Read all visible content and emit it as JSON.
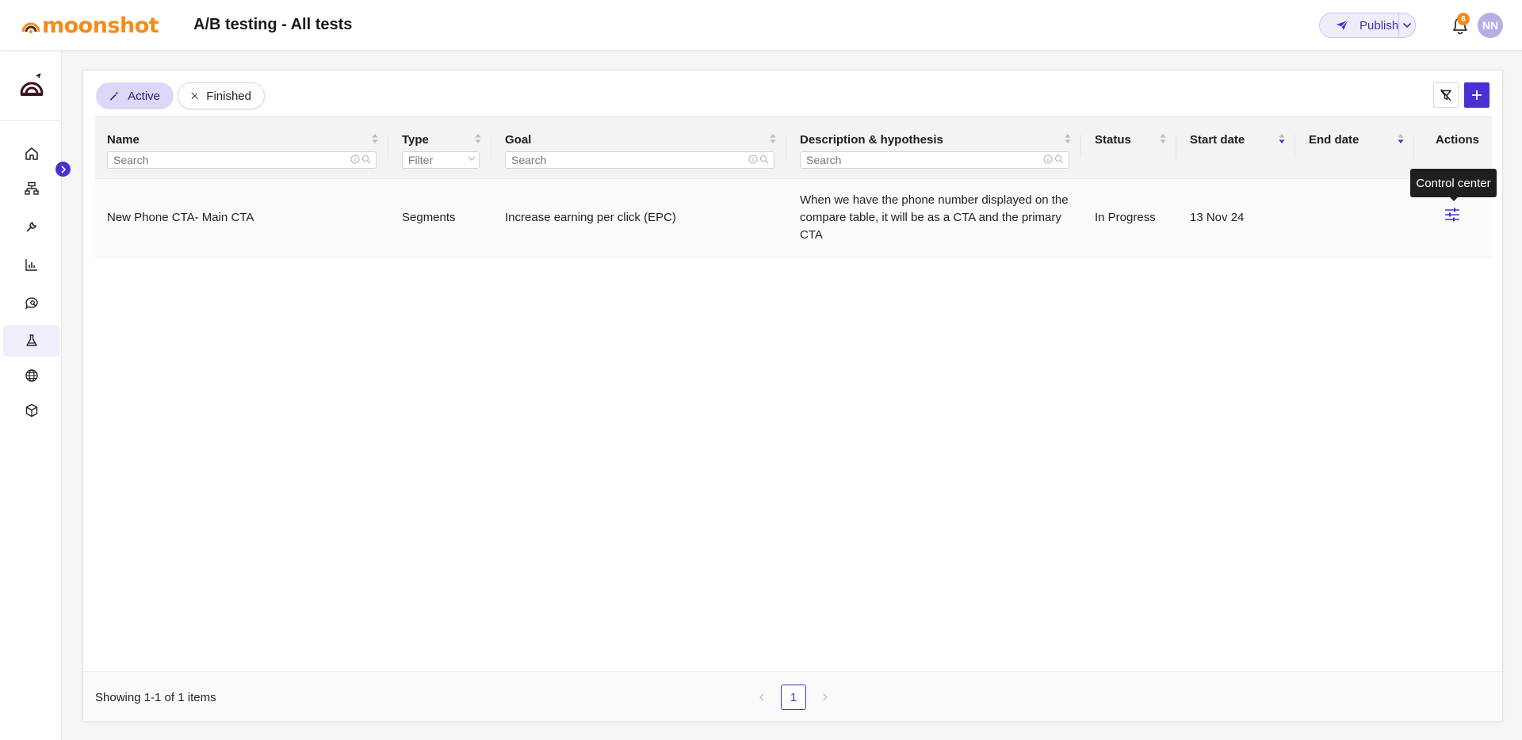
{
  "header": {
    "logo_text": "moonshot",
    "title": "A/B testing - All tests",
    "publish_label": "Publish",
    "notification_count": "6",
    "avatar_initials": "NN"
  },
  "sidebar": {
    "items": [
      {
        "name": "home",
        "icon": "home-icon"
      },
      {
        "name": "sitemap",
        "icon": "sitemap-icon"
      },
      {
        "name": "tools",
        "icon": "wrench-icon"
      },
      {
        "name": "analytics",
        "icon": "bar-chart-icon"
      },
      {
        "name": "search-messages",
        "icon": "chat-search-icon"
      },
      {
        "name": "ab-testing",
        "icon": "flask-icon",
        "active": true
      },
      {
        "name": "websites",
        "icon": "globe-icon"
      },
      {
        "name": "products",
        "icon": "cube-icon"
      }
    ]
  },
  "filters": {
    "active_label": "Active",
    "finished_label": "Finished"
  },
  "table": {
    "columns": {
      "name": "Name",
      "type": "Type",
      "goal": "Goal",
      "description": "Description & hypothesis",
      "status": "Status",
      "start_date": "Start date",
      "end_date": "End date",
      "actions": "Actions"
    },
    "placeholders": {
      "name": "Search",
      "type": "Filter",
      "goal": "Search",
      "description": "Search"
    },
    "rows": [
      {
        "name": "New Phone CTA- Main CTA",
        "type": "Segments",
        "goal": "Increase earning per click (EPC)",
        "description": "When we have the phone number displayed on the compare table, it will be as a CTA and the primary CTA",
        "status": "In Progress",
        "start_date": "13 Nov 24",
        "end_date": ""
      }
    ]
  },
  "tooltip": "Control center",
  "pagination": {
    "summary": "Showing 1-1 of 1 items",
    "current_page": "1"
  },
  "colors": {
    "accent": "#4b2fd0",
    "brand_orange": "#f28c1b",
    "active_chip": "#ddd6f7"
  }
}
